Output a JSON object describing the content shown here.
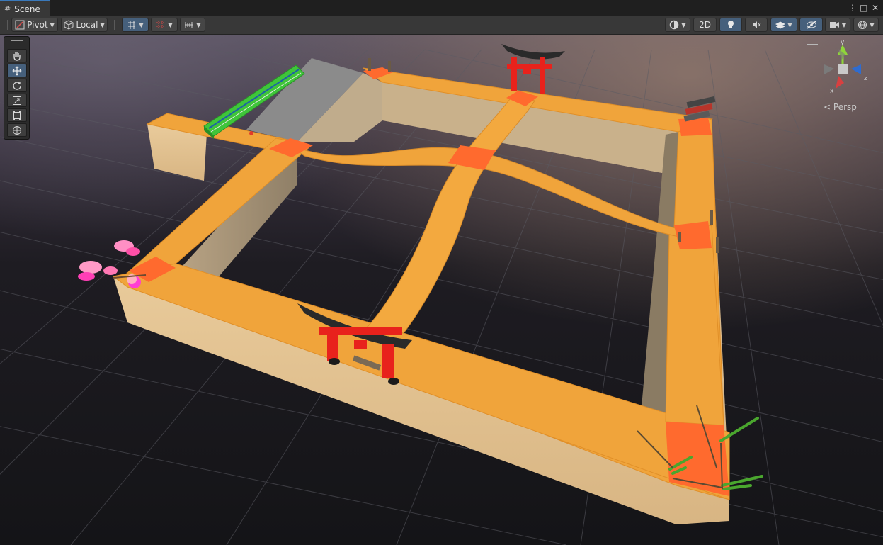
{
  "window": {
    "tab_title": "Scene",
    "controls": {
      "more": "⋮",
      "maximize": "□",
      "close": "✕"
    }
  },
  "toolbar": {
    "pivot_label": "Pivot",
    "local_label": "Local",
    "two_d_label": "2D"
  },
  "tools": [
    "hand-tool",
    "move-tool",
    "rotate-tool",
    "scale-tool",
    "rect-tool",
    "transform-tool"
  ],
  "active_tool": "move-tool",
  "gizmo": {
    "projection_label": "Persp",
    "x_label": "x",
    "y_label": "y",
    "z_label": "z"
  },
  "scene": {
    "objects": [
      "train",
      "torii-gate-back",
      "torii-gate-front",
      "pink-blossom-tree",
      "bamboo-cluster",
      "street-lamps"
    ],
    "colors": {
      "road": "#f0a43b",
      "intersection": "#ff6a2e",
      "wall": "#e3c393",
      "train": "#3fc53a",
      "torii": "#e8221c",
      "blossom": "#ff7fb8",
      "bamboo": "#4aa62e"
    }
  }
}
